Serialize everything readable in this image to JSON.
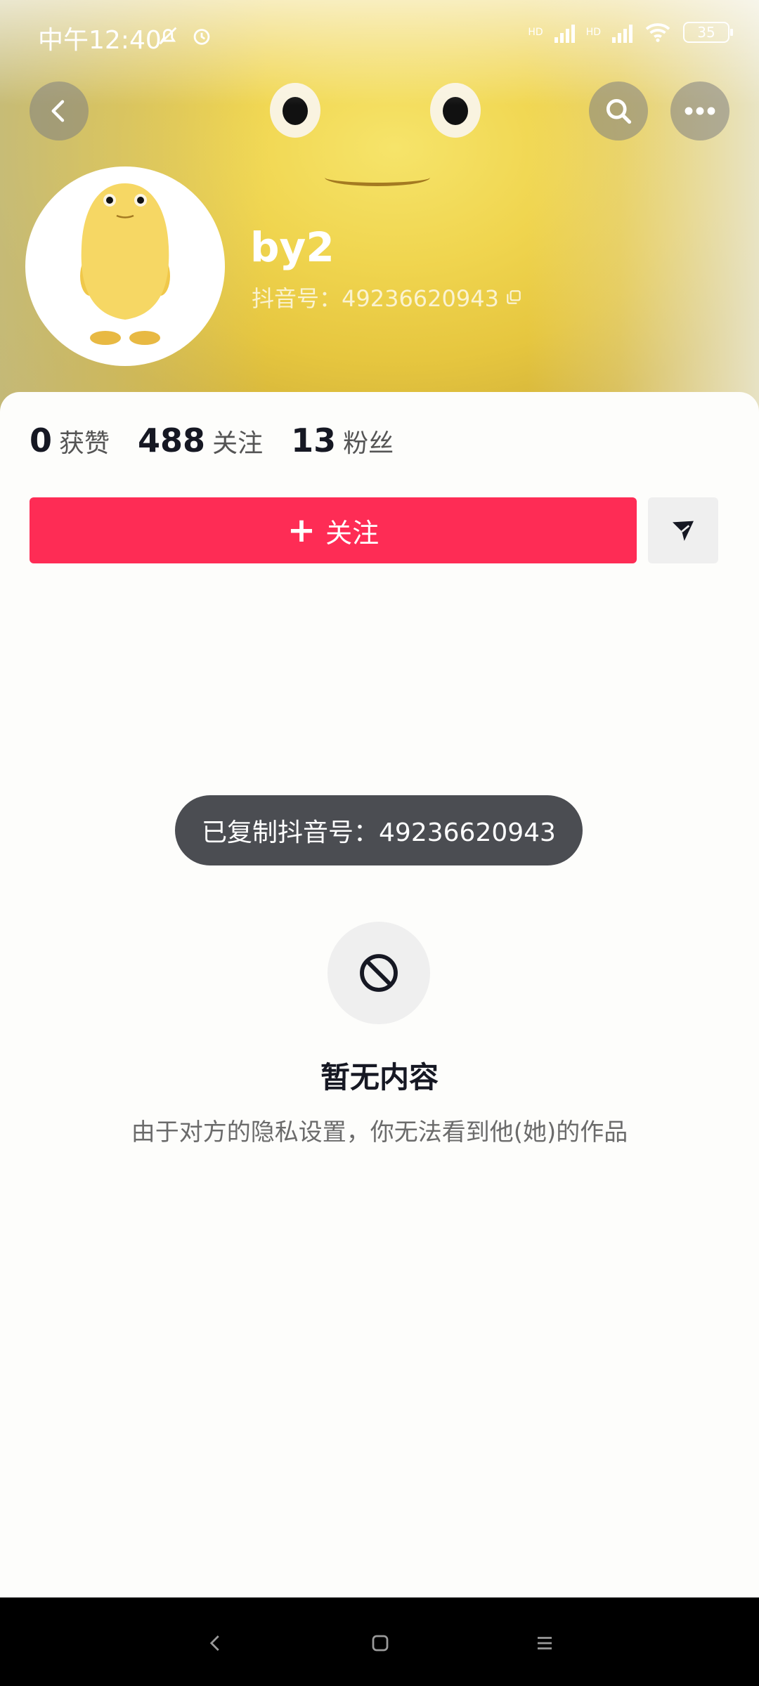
{
  "status_bar": {
    "time": "中午12:40",
    "hd1": "HD",
    "hd2": "HD",
    "battery": "35"
  },
  "header": {
    "back_icon": "chevron-left-icon",
    "search_icon": "search-icon",
    "more_icon": "more-dots-icon"
  },
  "profile": {
    "name": "by2",
    "douyin_id": "抖音号：49236620943",
    "copy_icon": "copy-icon"
  },
  "stats": [
    {
      "value": "0",
      "label": "获赞"
    },
    {
      "value": "488",
      "label": "关注"
    },
    {
      "value": "13",
      "label": "粉丝"
    }
  ],
  "actions": {
    "follow_label": "关注",
    "share_icon": "send-icon"
  },
  "toast": {
    "text": "已复制抖音号：49236620943"
  },
  "empty_state": {
    "icon": "prohibited-icon",
    "title": "暂无内容",
    "description": "由于对方的隐私设置，你无法看到他(她)的作品"
  },
  "colors": {
    "accent": "#fe2c55",
    "toast_bg": "#4b4d52"
  }
}
